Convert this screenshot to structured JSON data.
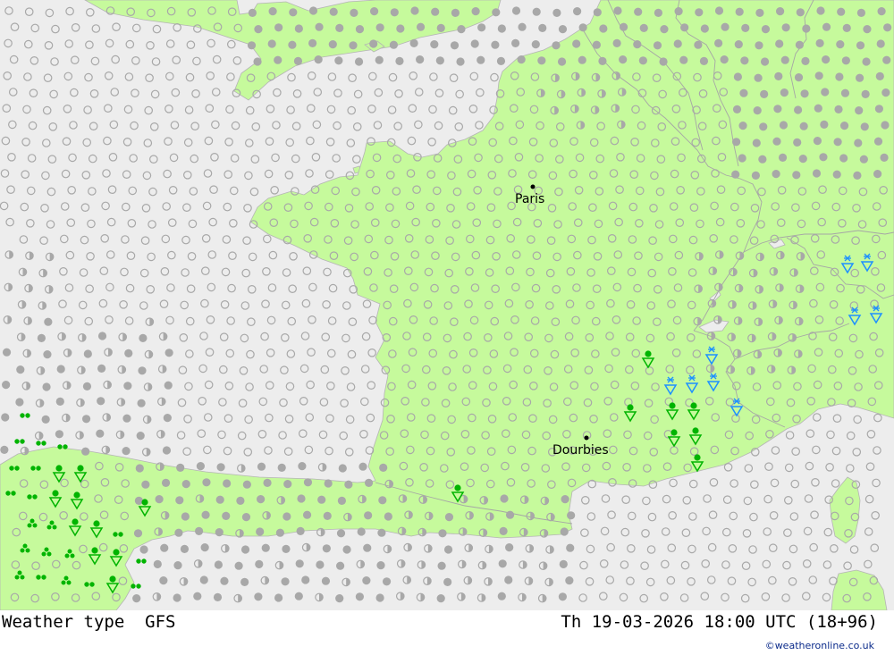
{
  "map": {
    "colors": {
      "sea": "#ededed",
      "land": "#c6fa9c",
      "border": "#a6a6a6",
      "cloud_symbol": "#a8a8a8",
      "rain_symbol": "#00b400",
      "snow_symbol": "#1e90ff"
    },
    "cities": [
      {
        "name": "Paris"
      },
      {
        "name": "Dourbies"
      }
    ],
    "legend_symbols": [
      "clear-sky",
      "partly-cloudy",
      "overcast",
      "rain-showers",
      "drizzle",
      "snow-showers"
    ]
  },
  "footer": {
    "title": "Weather type  GFS",
    "datetime": "Th 19-03-2026 18:00 UTC (18+96)",
    "credit": "©weatheronline.co.uk"
  }
}
